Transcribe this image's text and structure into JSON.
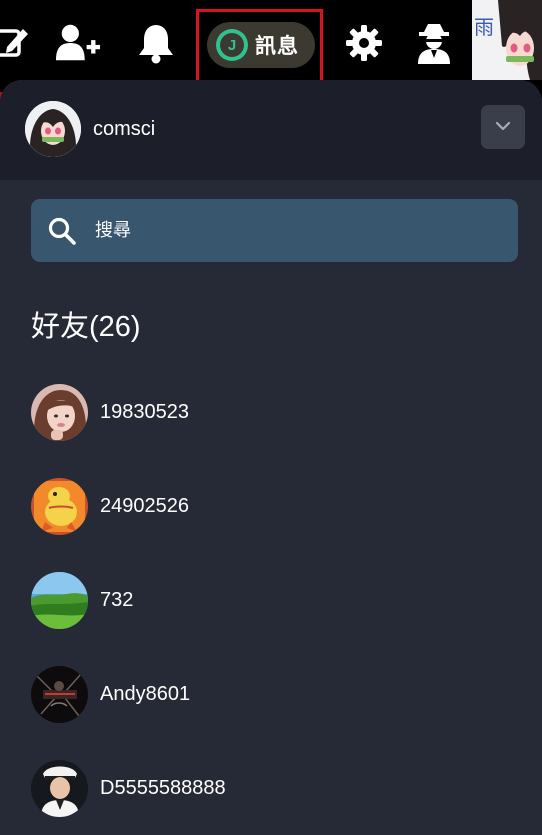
{
  "topbar": {
    "messages_label": "訊息",
    "messages_logo": "J",
    "profile_kanji": "雨"
  },
  "account": {
    "username": "comsci"
  },
  "search": {
    "placeholder": "搜尋"
  },
  "friends": {
    "title": "好友(26)",
    "items": [
      {
        "name": "19830523"
      },
      {
        "name": "24902526"
      },
      {
        "name": "732"
      },
      {
        "name": "Andy8601"
      },
      {
        "name": "D5555588888"
      }
    ]
  },
  "colors": {
    "topbar_bg": "#000000",
    "panel_bg": "#262a36",
    "header_bg": "#1c1f29",
    "search_bg": "#38576f",
    "accent_green": "#2ec28e",
    "highlight_red": "#d7141b"
  },
  "icons": [
    "edit-icon",
    "add-friend-icon",
    "bell-icon",
    "messages-logo-icon",
    "gear-icon",
    "incognito-icon",
    "chevron-down-icon",
    "search-icon"
  ]
}
